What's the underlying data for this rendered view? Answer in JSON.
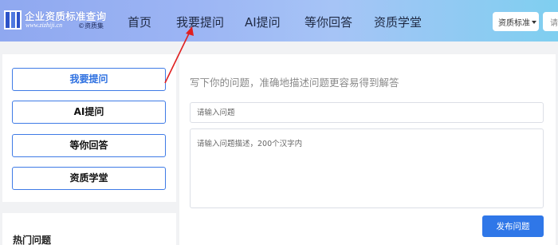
{
  "header": {
    "logo_title": "企业资质标准查询",
    "logo_url": "www.zizhiji.cn",
    "logo_brand": "©资质集",
    "nav": [
      "首页",
      "我要提问",
      "AI提问",
      "等你回答",
      "资质学堂"
    ],
    "dropdown_label": "资质标准",
    "search_stub": "请"
  },
  "sidebar": {
    "buttons": [
      "我要提问",
      "AI提问",
      "等你回答",
      "资质学堂"
    ],
    "hot_title": "热门问题"
  },
  "main": {
    "hint": "写下你的问题，准确地描述问题更容易得到解答",
    "question_placeholder": "请输入问题",
    "description_placeholder": "请输入问题描述，200个汉字内",
    "submit_label": "发布问题"
  },
  "colors": {
    "accent": "#2f77e8",
    "annotation_arrow": "#e02020"
  }
}
